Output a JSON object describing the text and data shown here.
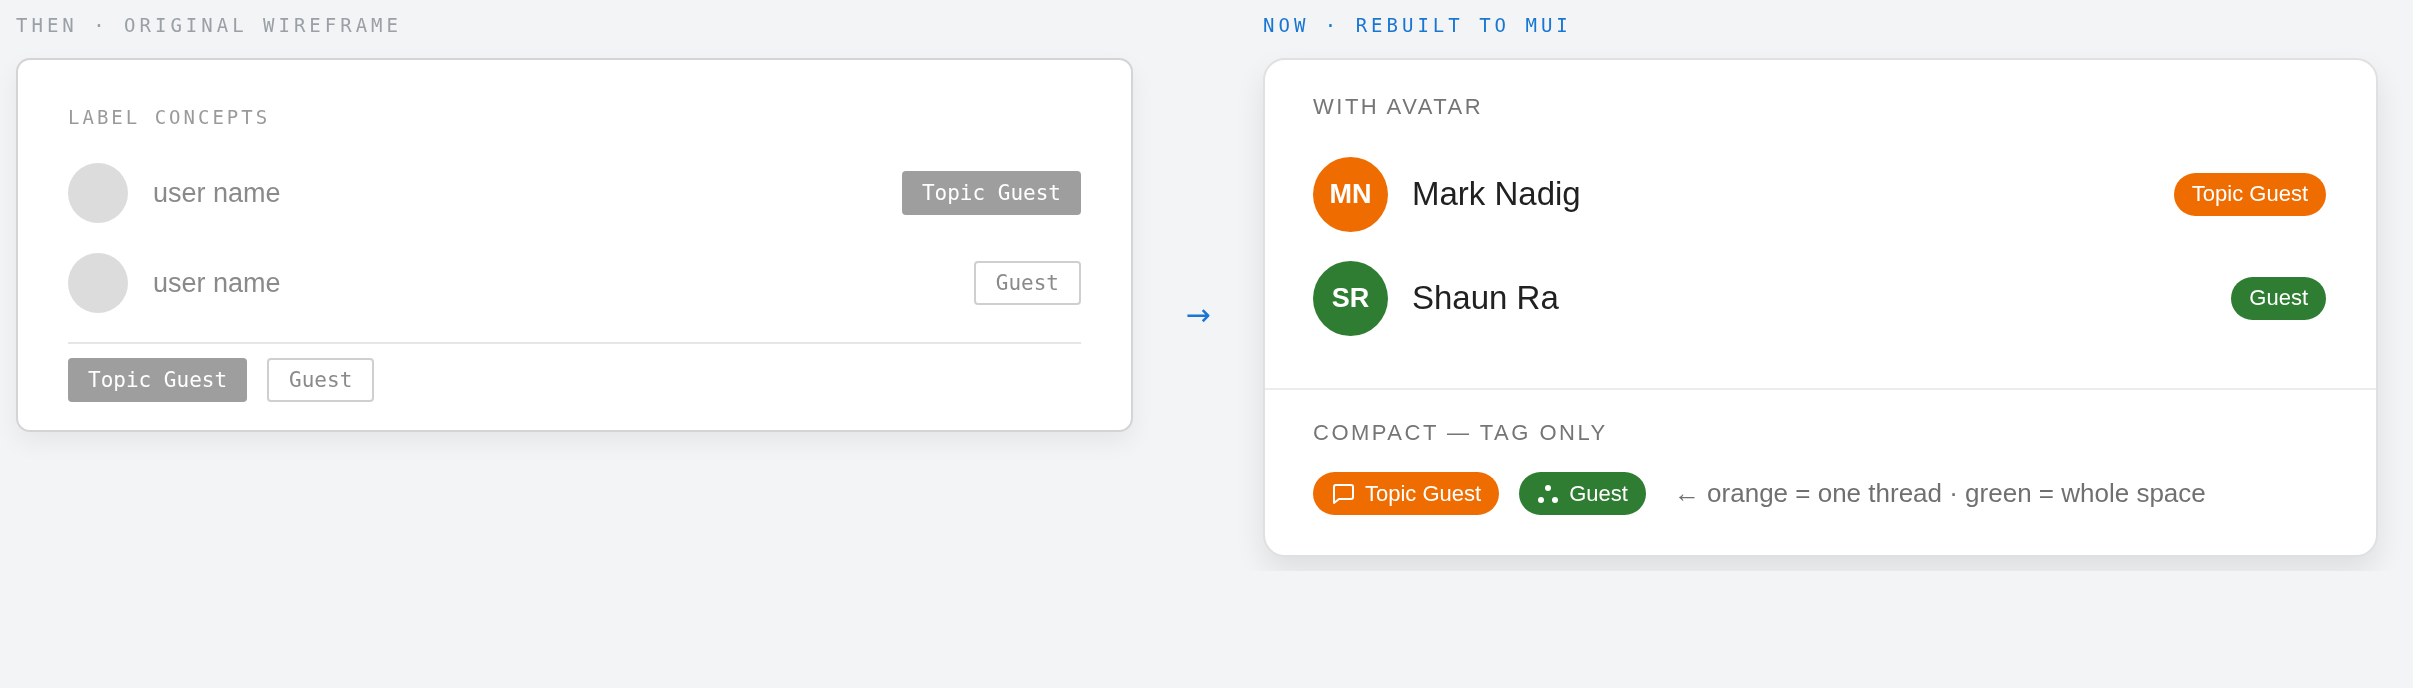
{
  "wireframe": {
    "heading": "THEN · ORIGINAL WIREFRAME",
    "card_title": "LABEL CONCEPTS",
    "rows": [
      {
        "name": "user name",
        "tag": {
          "label": "Topic Guest",
          "kind": "filled"
        }
      },
      {
        "name": "user name",
        "tag": {
          "label": "Guest",
          "kind": "outlined"
        }
      }
    ],
    "footer_tags": [
      {
        "label": "Topic Guest",
        "kind": "filled"
      },
      {
        "label": "Guest",
        "kind": "outlined"
      }
    ]
  },
  "arrow": "→",
  "rebuilt": {
    "heading": "NOW · REBUILT TO MUI",
    "avatar_section": {
      "title": "WITH AVATAR",
      "rows": [
        {
          "initials": "MN",
          "name": "Mark Nadig",
          "color": "#ef6c00",
          "tag": {
            "label": "Topic Guest",
            "color": "#ef6c00"
          }
        },
        {
          "initials": "SR",
          "name": "Shaun Ra",
          "color": "#2e7d32",
          "tag": {
            "label": "Guest",
            "color": "#2e7d32"
          }
        }
      ]
    },
    "compact_section": {
      "title": "COMPACT — TAG ONLY",
      "tags": [
        {
          "label": "Topic Guest",
          "color": "#ef6c00",
          "kind": "thread"
        },
        {
          "label": "Guest",
          "color": "#2e7d32",
          "kind": "space"
        }
      ],
      "legend": "← orange = one thread · green = whole space"
    }
  }
}
